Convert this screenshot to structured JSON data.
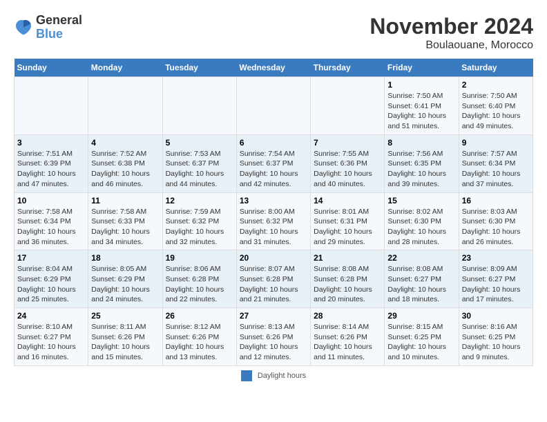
{
  "logo": {
    "line1": "General",
    "line2": "Blue"
  },
  "title": "November 2024",
  "subtitle": "Boulaouane, Morocco",
  "days_of_week": [
    "Sunday",
    "Monday",
    "Tuesday",
    "Wednesday",
    "Thursday",
    "Friday",
    "Saturday"
  ],
  "footer_label": "Daylight hours",
  "weeks": [
    [
      {
        "day": "",
        "info": ""
      },
      {
        "day": "",
        "info": ""
      },
      {
        "day": "",
        "info": ""
      },
      {
        "day": "",
        "info": ""
      },
      {
        "day": "",
        "info": ""
      },
      {
        "day": "1",
        "info": "Sunrise: 7:50 AM\nSunset: 6:41 PM\nDaylight: 10 hours and 51 minutes."
      },
      {
        "day": "2",
        "info": "Sunrise: 7:50 AM\nSunset: 6:40 PM\nDaylight: 10 hours and 49 minutes."
      }
    ],
    [
      {
        "day": "3",
        "info": "Sunrise: 7:51 AM\nSunset: 6:39 PM\nDaylight: 10 hours and 47 minutes."
      },
      {
        "day": "4",
        "info": "Sunrise: 7:52 AM\nSunset: 6:38 PM\nDaylight: 10 hours and 46 minutes."
      },
      {
        "day": "5",
        "info": "Sunrise: 7:53 AM\nSunset: 6:37 PM\nDaylight: 10 hours and 44 minutes."
      },
      {
        "day": "6",
        "info": "Sunrise: 7:54 AM\nSunset: 6:37 PM\nDaylight: 10 hours and 42 minutes."
      },
      {
        "day": "7",
        "info": "Sunrise: 7:55 AM\nSunset: 6:36 PM\nDaylight: 10 hours and 40 minutes."
      },
      {
        "day": "8",
        "info": "Sunrise: 7:56 AM\nSunset: 6:35 PM\nDaylight: 10 hours and 39 minutes."
      },
      {
        "day": "9",
        "info": "Sunrise: 7:57 AM\nSunset: 6:34 PM\nDaylight: 10 hours and 37 minutes."
      }
    ],
    [
      {
        "day": "10",
        "info": "Sunrise: 7:58 AM\nSunset: 6:34 PM\nDaylight: 10 hours and 36 minutes."
      },
      {
        "day": "11",
        "info": "Sunrise: 7:58 AM\nSunset: 6:33 PM\nDaylight: 10 hours and 34 minutes."
      },
      {
        "day": "12",
        "info": "Sunrise: 7:59 AM\nSunset: 6:32 PM\nDaylight: 10 hours and 32 minutes."
      },
      {
        "day": "13",
        "info": "Sunrise: 8:00 AM\nSunset: 6:32 PM\nDaylight: 10 hours and 31 minutes."
      },
      {
        "day": "14",
        "info": "Sunrise: 8:01 AM\nSunset: 6:31 PM\nDaylight: 10 hours and 29 minutes."
      },
      {
        "day": "15",
        "info": "Sunrise: 8:02 AM\nSunset: 6:30 PM\nDaylight: 10 hours and 28 minutes."
      },
      {
        "day": "16",
        "info": "Sunrise: 8:03 AM\nSunset: 6:30 PM\nDaylight: 10 hours and 26 minutes."
      }
    ],
    [
      {
        "day": "17",
        "info": "Sunrise: 8:04 AM\nSunset: 6:29 PM\nDaylight: 10 hours and 25 minutes."
      },
      {
        "day": "18",
        "info": "Sunrise: 8:05 AM\nSunset: 6:29 PM\nDaylight: 10 hours and 24 minutes."
      },
      {
        "day": "19",
        "info": "Sunrise: 8:06 AM\nSunset: 6:28 PM\nDaylight: 10 hours and 22 minutes."
      },
      {
        "day": "20",
        "info": "Sunrise: 8:07 AM\nSunset: 6:28 PM\nDaylight: 10 hours and 21 minutes."
      },
      {
        "day": "21",
        "info": "Sunrise: 8:08 AM\nSunset: 6:28 PM\nDaylight: 10 hours and 20 minutes."
      },
      {
        "day": "22",
        "info": "Sunrise: 8:08 AM\nSunset: 6:27 PM\nDaylight: 10 hours and 18 minutes."
      },
      {
        "day": "23",
        "info": "Sunrise: 8:09 AM\nSunset: 6:27 PM\nDaylight: 10 hours and 17 minutes."
      }
    ],
    [
      {
        "day": "24",
        "info": "Sunrise: 8:10 AM\nSunset: 6:27 PM\nDaylight: 10 hours and 16 minutes."
      },
      {
        "day": "25",
        "info": "Sunrise: 8:11 AM\nSunset: 6:26 PM\nDaylight: 10 hours and 15 minutes."
      },
      {
        "day": "26",
        "info": "Sunrise: 8:12 AM\nSunset: 6:26 PM\nDaylight: 10 hours and 13 minutes."
      },
      {
        "day": "27",
        "info": "Sunrise: 8:13 AM\nSunset: 6:26 PM\nDaylight: 10 hours and 12 minutes."
      },
      {
        "day": "28",
        "info": "Sunrise: 8:14 AM\nSunset: 6:26 PM\nDaylight: 10 hours and 11 minutes."
      },
      {
        "day": "29",
        "info": "Sunrise: 8:15 AM\nSunset: 6:25 PM\nDaylight: 10 hours and 10 minutes."
      },
      {
        "day": "30",
        "info": "Sunrise: 8:16 AM\nSunset: 6:25 PM\nDaylight: 10 hours and 9 minutes."
      }
    ]
  ]
}
